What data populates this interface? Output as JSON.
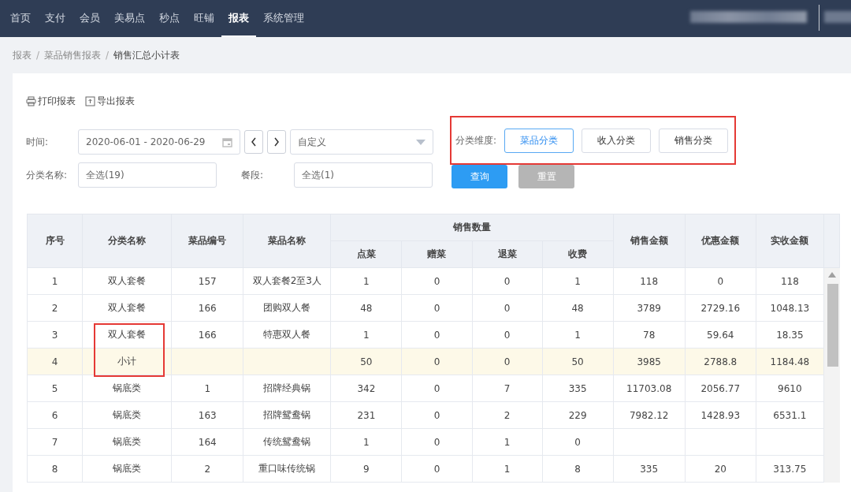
{
  "nav": {
    "items": [
      {
        "label": "首页",
        "selected": false
      },
      {
        "label": "支付",
        "selected": false
      },
      {
        "label": "会员",
        "selected": false
      },
      {
        "label": "美易点",
        "selected": false
      },
      {
        "label": "秒点",
        "selected": false
      },
      {
        "label": "旺铺",
        "selected": false
      },
      {
        "label": "报表",
        "selected": true
      },
      {
        "label": "系统管理",
        "selected": false
      }
    ]
  },
  "breadcrumb": [
    {
      "label": "报表"
    },
    {
      "separator": "/",
      "label": "菜品销售报表"
    },
    {
      "separator": "/",
      "label": "销售汇总小计表"
    }
  ],
  "toolbar": [
    {
      "kind": "print",
      "label": "打印报表"
    },
    {
      "kind": "export",
      "label": "导出报表"
    }
  ],
  "filters": {
    "time": {
      "label": "时间:",
      "value": "2020-06-01 - 2020-06-29"
    },
    "period": {
      "value": "自定义"
    },
    "category_name": {
      "label": "分类名称:",
      "value": "全选(19)"
    },
    "meal_period": {
      "label": "餐段:",
      "value": "全选(1)"
    }
  },
  "dimension": {
    "label": "分类维度:",
    "highlighted": true,
    "options": [
      {
        "label": "菜品分类",
        "selected": true
      },
      {
        "label": "收入分类",
        "selected": false
      },
      {
        "label": "销售分类",
        "selected": false
      }
    ]
  },
  "actions": [
    {
      "label": "查询",
      "disabled": false
    },
    {
      "label": "重置",
      "disabled": true
    }
  ],
  "table": {
    "column_groups": [
      {
        "label": "销售数量"
      }
    ],
    "columns": [
      {
        "label": "序号",
        "grouped": false
      },
      {
        "label": "分类名称",
        "grouped": false
      },
      {
        "label": "菜品编号",
        "grouped": false
      },
      {
        "label": "菜品名称",
        "grouped": false
      },
      {
        "label": "点菜",
        "grouped": true
      },
      {
        "label": "赠菜",
        "grouped": true
      },
      {
        "label": "退菜",
        "grouped": true
      },
      {
        "label": "收费",
        "grouped": true
      },
      {
        "label": "销售金额",
        "grouped": false
      },
      {
        "label": "优惠金额",
        "grouped": false
      },
      {
        "label": "实收金额",
        "grouped": false
      }
    ],
    "rows": [
      {
        "kind": "item",
        "highlighted": false,
        "cells": [
          "1",
          "双人套餐",
          "157",
          "双人套餐2至3人",
          "1",
          "0",
          "0",
          "1",
          "118",
          "0",
          "118"
        ]
      },
      {
        "kind": "item",
        "highlighted": false,
        "cells": [
          "2",
          "双人套餐",
          "166",
          "团购双人餐",
          "48",
          "0",
          "0",
          "48",
          "3789",
          "2729.16",
          "1048.13"
        ]
      },
      {
        "kind": "item",
        "highlighted": true,
        "cells": [
          "3",
          "双人套餐",
          "166",
          "特惠双人餐",
          "1",
          "0",
          "0",
          "1",
          "78",
          "59.64",
          "18.35"
        ]
      },
      {
        "kind": "subtotal",
        "highlighted": true,
        "cells": [
          "4",
          "小计",
          null,
          null,
          "50",
          "0",
          "0",
          "50",
          "3985",
          "2788.8",
          "1184.48"
        ]
      },
      {
        "kind": "item",
        "highlighted": false,
        "cells": [
          "5",
          "锅底类",
          "1",
          "招牌经典锅",
          "342",
          "0",
          "7",
          "335",
          "11703.08",
          "2056.77",
          "9610"
        ]
      },
      {
        "kind": "item",
        "highlighted": false,
        "cells": [
          "6",
          "锅底类",
          "163",
          "招牌鸳鸯锅",
          "231",
          "0",
          "2",
          "229",
          "7982.12",
          "1428.93",
          "6531.1"
        ]
      },
      {
        "kind": "item",
        "highlighted": false,
        "cells": [
          "7",
          "锅底类",
          "164",
          "传统鸳鸯锅",
          "1",
          "0",
          "1",
          "0",
          null,
          null,
          null
        ]
      },
      {
        "kind": "item",
        "highlighted": false,
        "cells": [
          "8",
          "锅底类",
          "2",
          "重口味传统锅",
          "9",
          "0",
          "1",
          "8",
          "335",
          "20",
          "313.75"
        ]
      }
    ]
  }
}
